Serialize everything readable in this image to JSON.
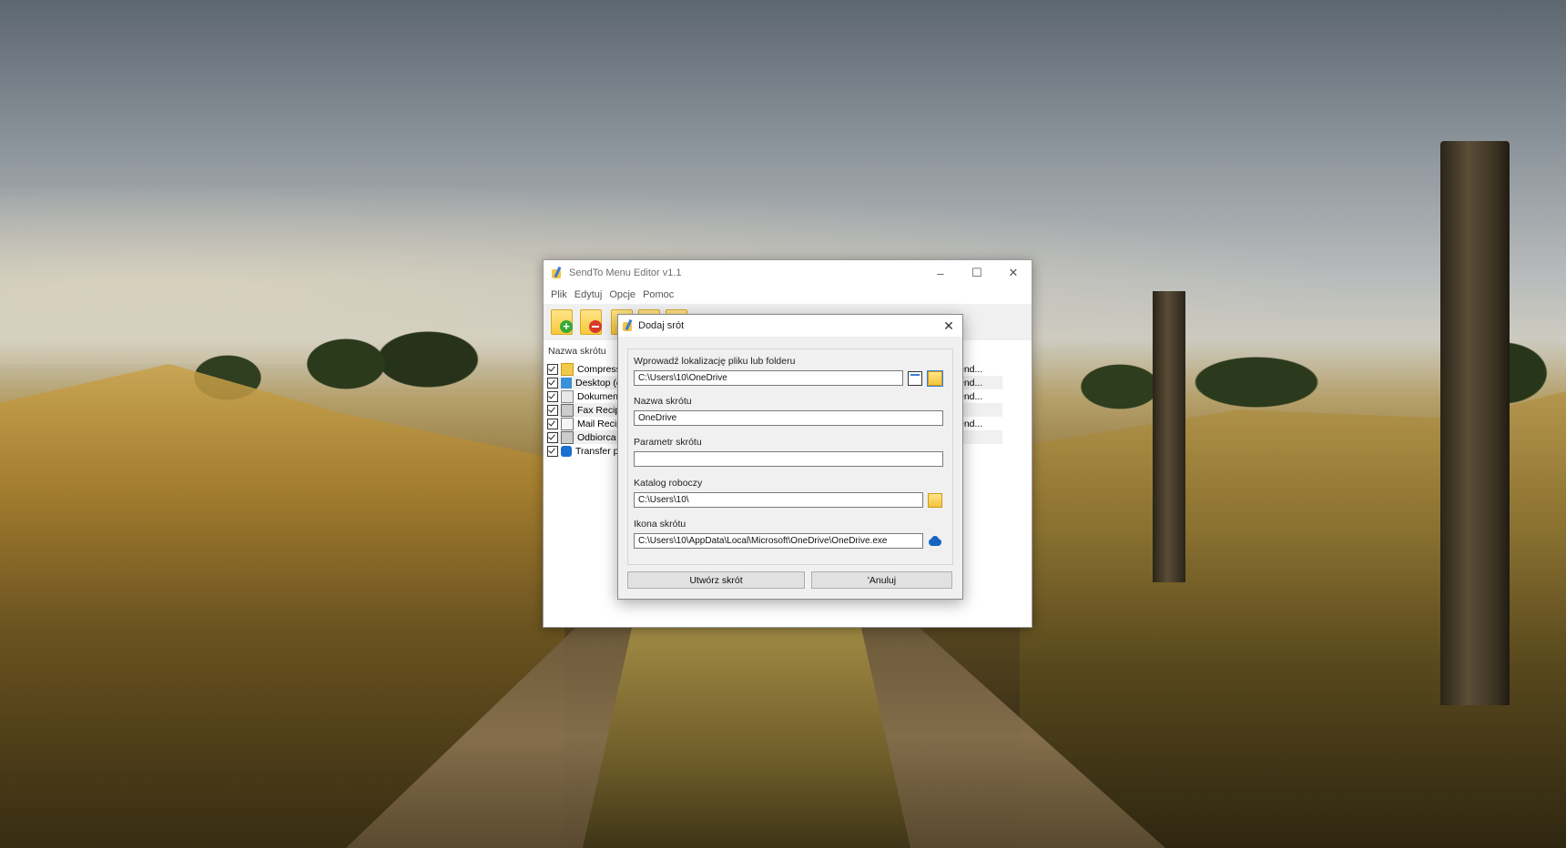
{
  "main_window": {
    "title": "SendTo Menu Editor v1.1",
    "controls": {
      "minimize": "–",
      "maximize": "☐",
      "close": "✕"
    },
    "menu": [
      "Plik",
      "Edytuj",
      "Opcje",
      "Pomoc"
    ],
    "list_header": "Nazwa skrótu",
    "items": [
      {
        "label": "Compresse",
        "icon": "zip-folder-icon",
        "send": "end..."
      },
      {
        "label": "Desktop (c",
        "icon": "desktop-icon",
        "send": "end..."
      },
      {
        "label": "Dokumenty",
        "icon": "document-icon",
        "send": "end..."
      },
      {
        "label": "Fax Recipi",
        "icon": "fax-icon",
        "send": ""
      },
      {
        "label": "Mail Recipi",
        "icon": "mail-icon",
        "send": "end..."
      },
      {
        "label": "Odbiorca f",
        "icon": "fax-icon",
        "send": ""
      },
      {
        "label": "Transfer pl",
        "icon": "bluetooth-icon",
        "send": ""
      }
    ]
  },
  "dialog": {
    "title": "Dodaj srót",
    "close": "✕",
    "location_label": "Wprowadź lokalizację pliku lub folderu",
    "location_value": "C:\\Users\\10\\OneDrive",
    "name_label": "Nazwa skrótu",
    "name_value": "OneDrive",
    "param_label": "Parametr skrótu",
    "param_value": "",
    "workdir_label": "Katalog roboczy",
    "workdir_value": "C:\\Users\\10\\",
    "icon_label": "Ikona skrótu",
    "icon_value": "C:\\Users\\10\\AppData\\Local\\Microsoft\\OneDrive\\OneDrive.exe",
    "create_button": "Utwórz skrót",
    "cancel_button": "'Anuluj"
  }
}
